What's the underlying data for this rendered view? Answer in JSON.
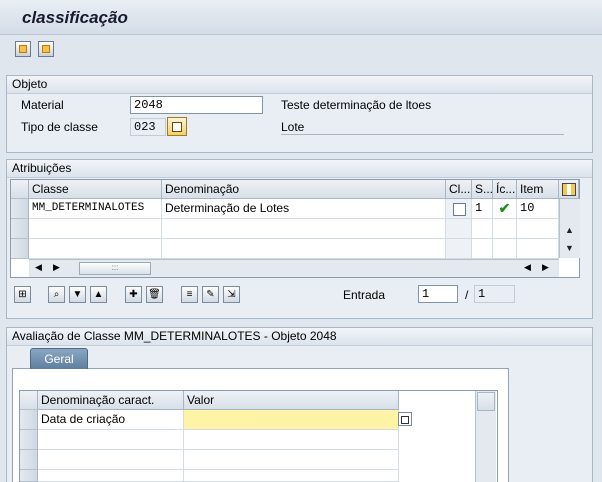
{
  "window": {
    "title": "classificação"
  },
  "toolbar": {
    "icons": [
      "back-icon",
      "forward-icon"
    ]
  },
  "objeto": {
    "header": "Objeto",
    "material_label": "Material",
    "material_value": "2048",
    "material_desc": "Teste determinação de ltoes",
    "tipo_label": "Tipo de classe",
    "tipo_value": "023",
    "tipo_desc": "Lote"
  },
  "atribuicoes": {
    "header": "Atribuições",
    "columns": [
      "Classe",
      "Denominação",
      "Cl...",
      "S...",
      "Íc...",
      "Item"
    ],
    "rows": [
      {
        "classe": "MM_DETERMINALOTES",
        "denominacao": "Determinação de Lotes",
        "status": "1",
        "item": "10"
      }
    ],
    "entrada_label": "Entrada",
    "entrada_value": "1",
    "entrada_sep": "/",
    "entrada_total": "1",
    "hscroll_marker": ":::"
  },
  "avaliacao": {
    "header": "Avaliação de Classe MM_DETERMINALOTES - Objeto 2048",
    "tab_label": "Geral",
    "columns": [
      "Denominação caract.",
      "Valor"
    ],
    "rows": [
      {
        "name": "Data de criação",
        "value": ""
      }
    ]
  }
}
